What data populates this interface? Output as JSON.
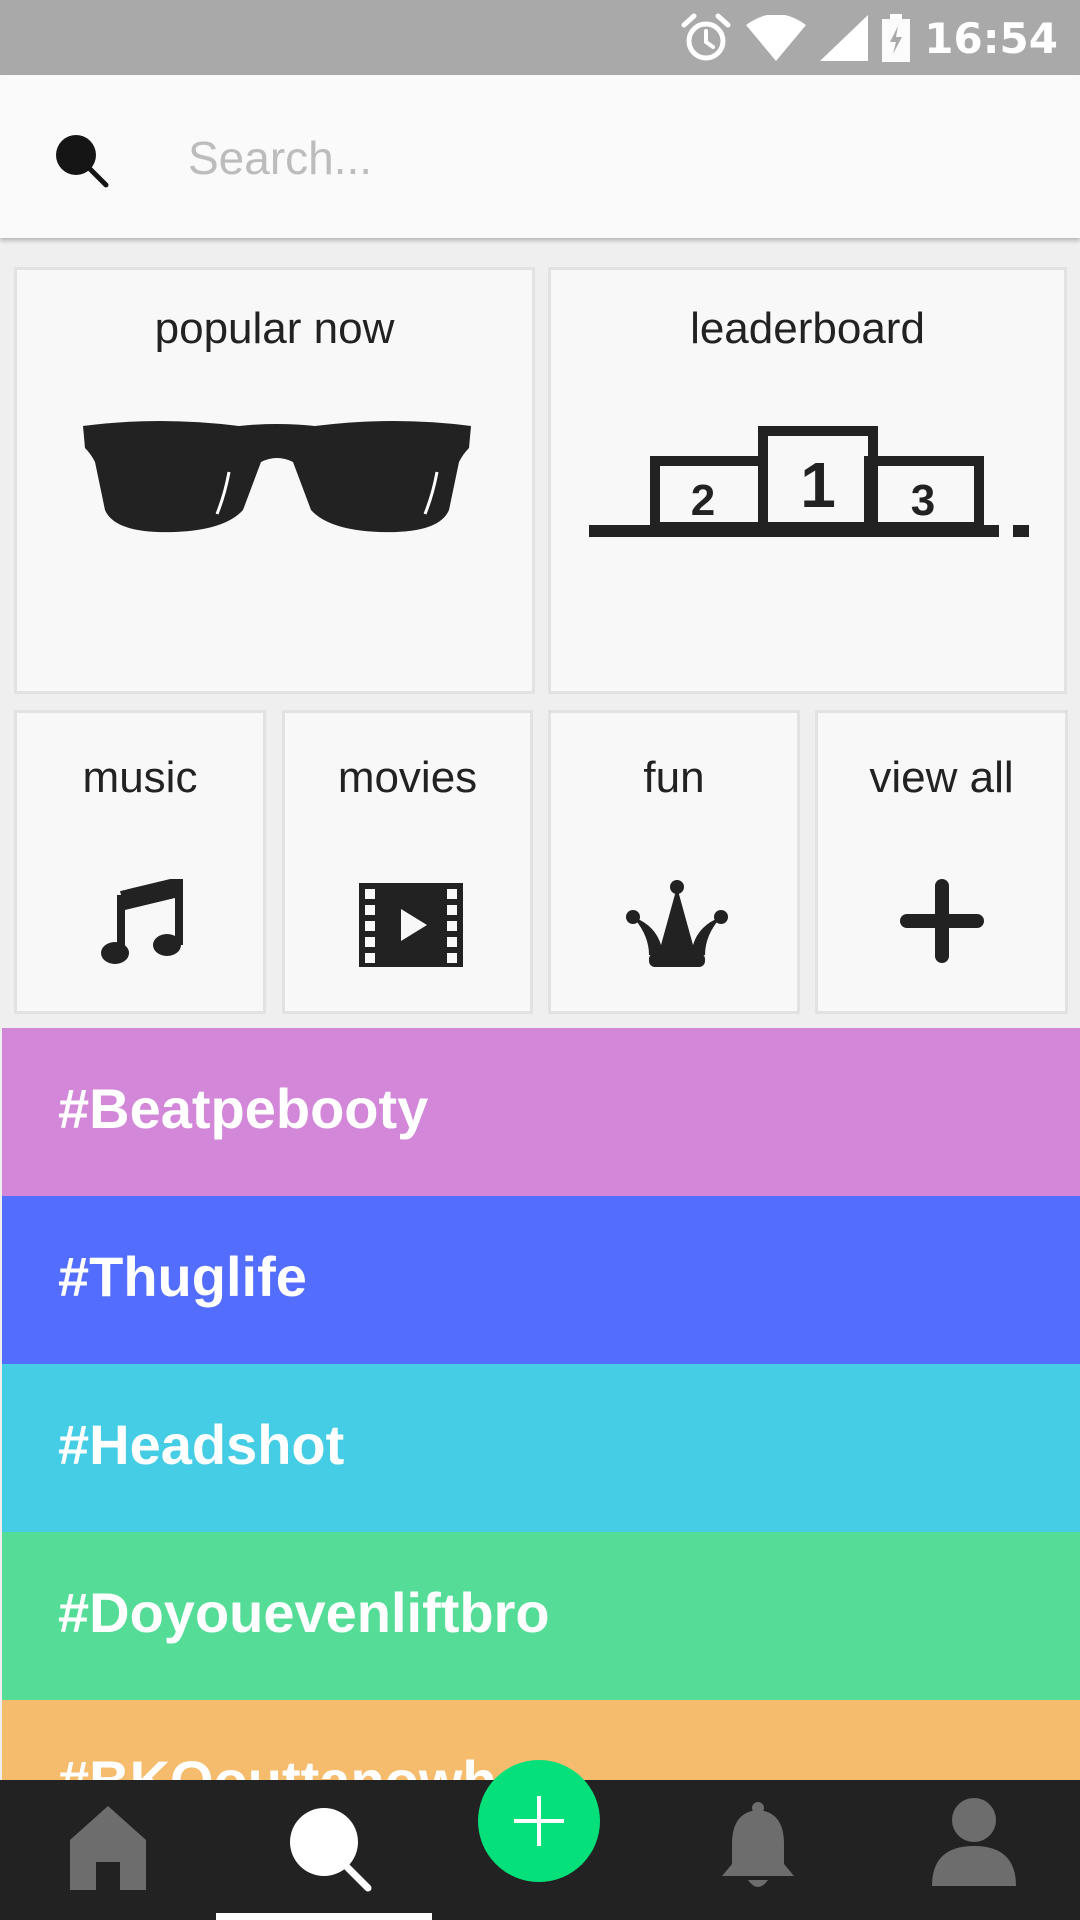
{
  "status_bar": {
    "time": "16:54",
    "icons": [
      "alarm-icon",
      "wifi-icon",
      "signal-icon",
      "battery-charging-icon"
    ]
  },
  "search": {
    "placeholder": "Search...",
    "value": "",
    "icon": "search-icon"
  },
  "featured": [
    {
      "label": "popular now",
      "icon": "sunglasses-icon"
    },
    {
      "label": "leaderboard",
      "icon": "podium-icon",
      "podium_numbers": [
        "2",
        "1",
        "3"
      ]
    }
  ],
  "categories": [
    {
      "label": "music",
      "icon": "music-note-icon"
    },
    {
      "label": "movies",
      "icon": "film-icon"
    },
    {
      "label": "fun",
      "icon": "jester-crown-icon"
    },
    {
      "label": "view all",
      "icon": "plus-icon"
    }
  ],
  "hashtags": [
    {
      "label": "#Beatpebooty",
      "color": "#d387d9"
    },
    {
      "label": "#Thuglife",
      "color": "#536dfe"
    },
    {
      "label": "#Headshot",
      "color": "#45cde5"
    },
    {
      "label": "#Doyouevenliftbro",
      "color": "#55dd98"
    },
    {
      "label": "#BKOouttanowhe",
      "color": "#f6bc6d"
    }
  ],
  "bottom_nav": {
    "items": [
      "home-icon",
      "search-icon",
      "bell-icon",
      "profile-icon"
    ],
    "active": "search",
    "fab_icon": "add-icon",
    "fab_color": "#05e07b"
  }
}
